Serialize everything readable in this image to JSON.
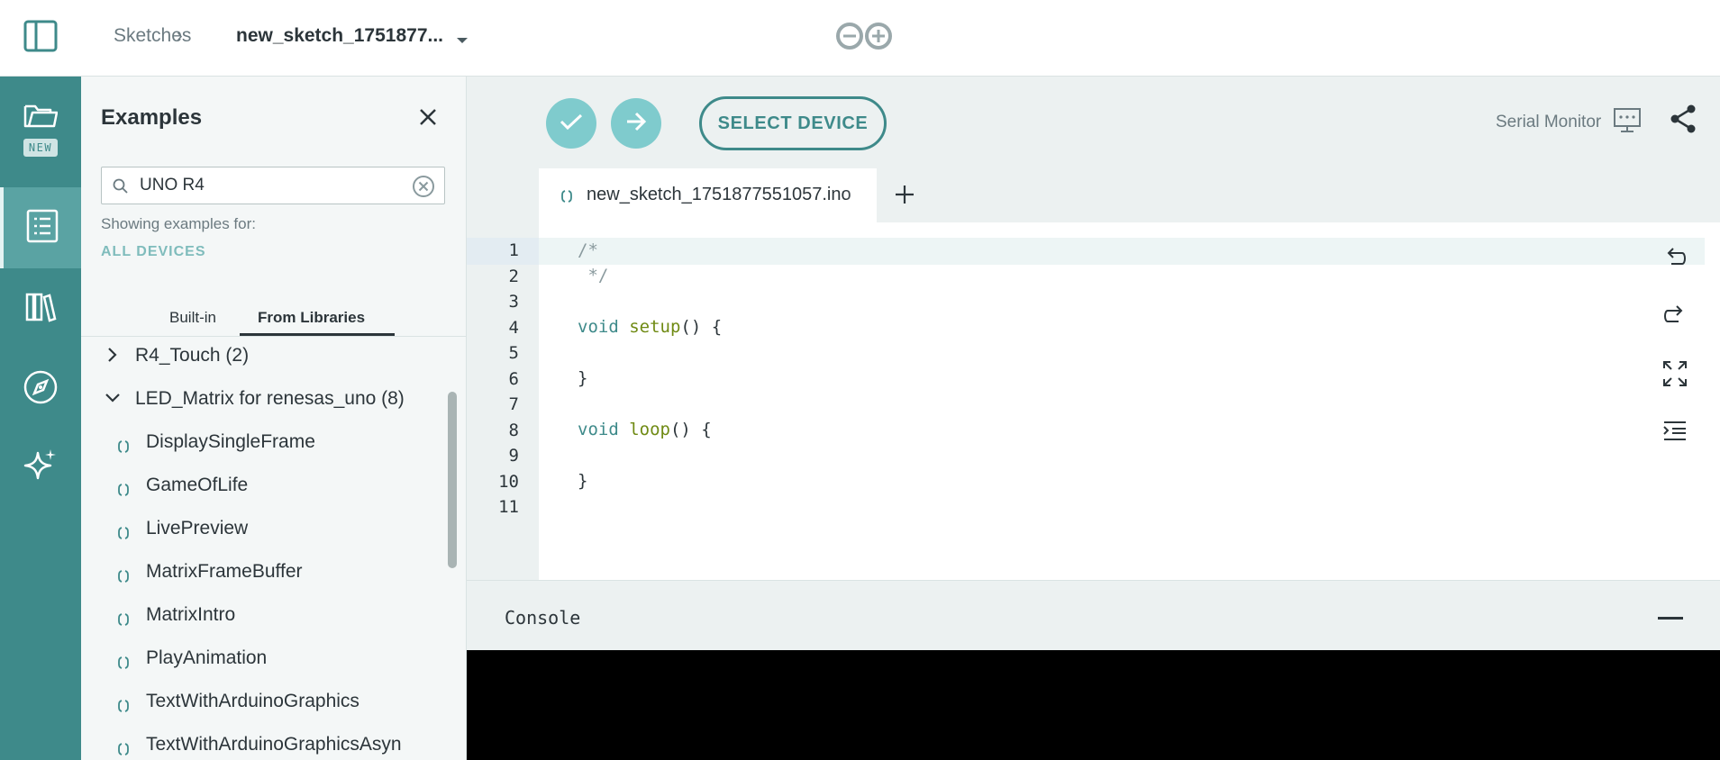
{
  "header": {
    "breadcrumb_root": "Sketches",
    "breadcrumb_sep": "›",
    "sketch_name": "new_sketch_1751877..."
  },
  "rail": {
    "new_badge": "NEW",
    "items": [
      {
        "icon": "folder-icon"
      },
      {
        "icon": "examples-icon"
      },
      {
        "icon": "libraries-icon"
      },
      {
        "icon": "reference-icon"
      },
      {
        "icon": "ai-assistant-icon"
      }
    ]
  },
  "panel": {
    "title": "Examples",
    "search_value": "UNO R4",
    "showing_label": "Showing examples for:",
    "device_filter": "ALL DEVICES",
    "tabs": {
      "builtin": "Built-in",
      "libraries": "From Libraries"
    },
    "tree": [
      {
        "label": "R4_Touch (2)",
        "type": "folder",
        "expanded": false
      },
      {
        "label": "LED_Matrix for renesas_uno (8)",
        "type": "folder",
        "expanded": true
      },
      {
        "label": "DisplaySingleFrame",
        "type": "example"
      },
      {
        "label": "GameOfLife",
        "type": "example"
      },
      {
        "label": "LivePreview",
        "type": "example"
      },
      {
        "label": "MatrixFrameBuffer",
        "type": "example"
      },
      {
        "label": "MatrixIntro",
        "type": "example"
      },
      {
        "label": "PlayAnimation",
        "type": "example"
      },
      {
        "label": "TextWithArduinoGraphics",
        "type": "example"
      },
      {
        "label": "TextWithArduinoGraphicsAsyn",
        "type": "example"
      }
    ]
  },
  "toolbar": {
    "select_device": "SELECT DEVICE",
    "serial_monitor": "Serial Monitor"
  },
  "editor": {
    "file_tab": "new_sketch_1751877551057.ino",
    "line_numbers": [
      "1",
      "2",
      "3",
      "4",
      "5",
      "6",
      "7",
      "8",
      "9",
      "10",
      "11"
    ],
    "code": {
      "l1": "/*",
      "l2": " */",
      "l4_kw": "void",
      "l4_fn": "setup",
      "l4_rest": "() {",
      "l6": "}",
      "l8_kw": "void",
      "l8_fn": "loop",
      "l8_rest": "() {",
      "l10": "}"
    }
  },
  "console": {
    "label": "Console"
  },
  "colors": {
    "accent": "#3e8a8a",
    "accent_light": "#7fcbcd",
    "rail_bg": "#3e8a8a"
  }
}
